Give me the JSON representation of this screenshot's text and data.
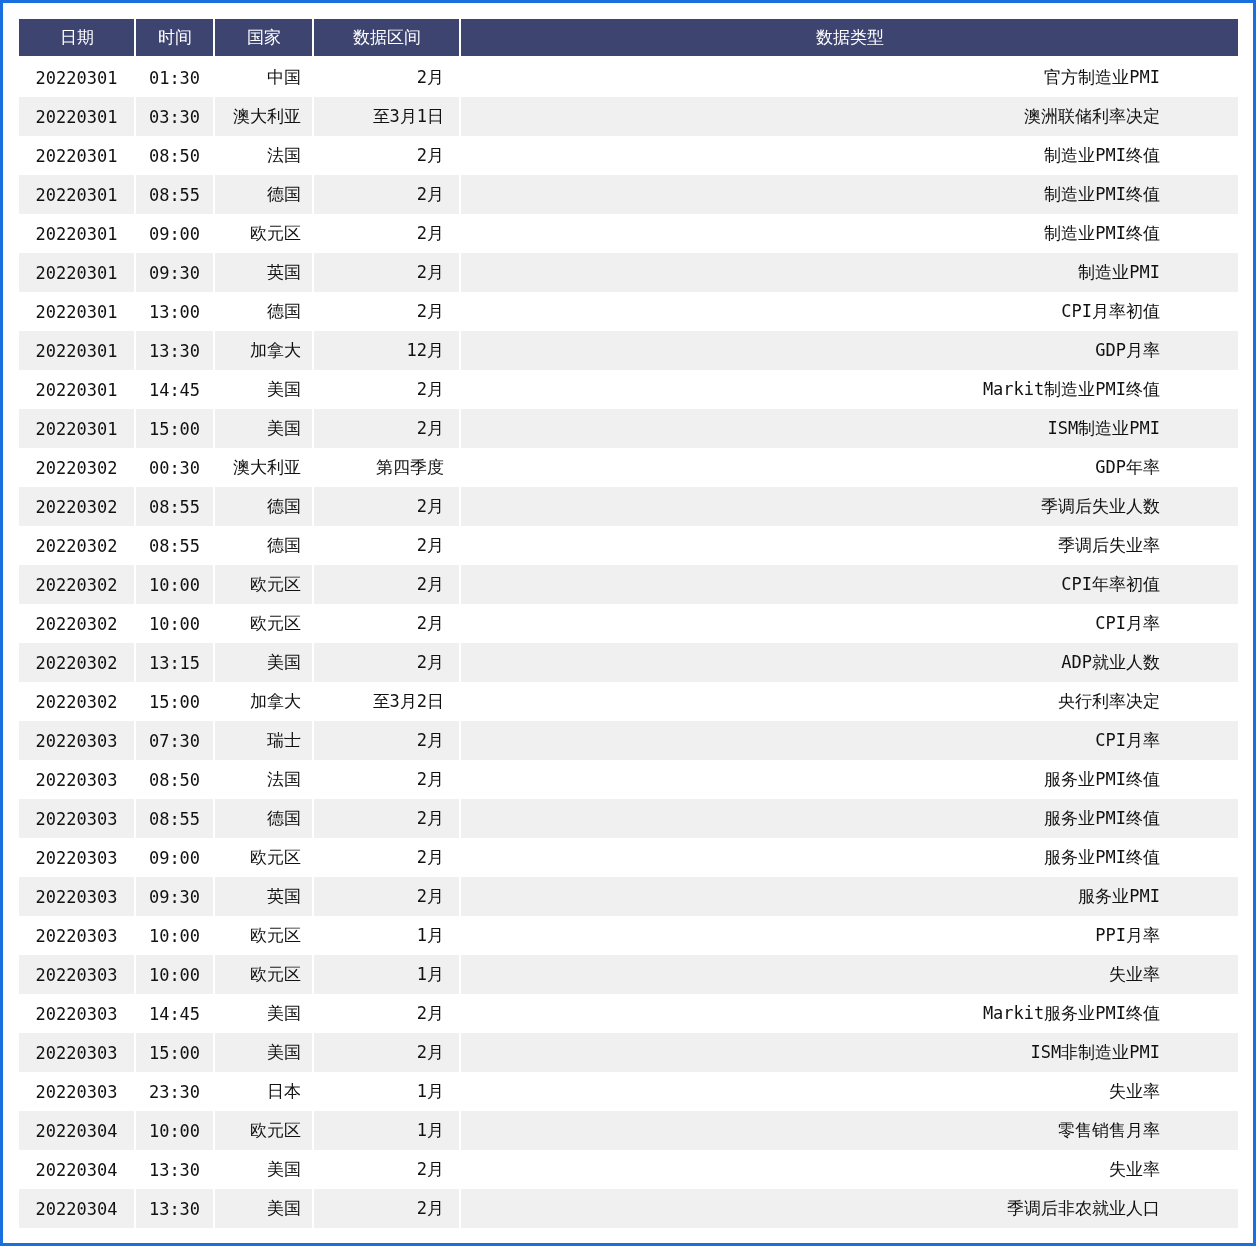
{
  "table": {
    "columns": [
      "日期",
      "时间",
      "国家",
      "数据区间",
      "数据类型"
    ],
    "rows": [
      [
        "20220301",
        "01:30",
        "中国",
        "2月",
        "官方制造业PMI"
      ],
      [
        "20220301",
        "03:30",
        "澳大利亚",
        "至3月1日",
        "澳洲联储利率决定"
      ],
      [
        "20220301",
        "08:50",
        "法国",
        "2月",
        "制造业PMI终值"
      ],
      [
        "20220301",
        "08:55",
        "德国",
        "2月",
        "制造业PMI终值"
      ],
      [
        "20220301",
        "09:00",
        "欧元区",
        "2月",
        "制造业PMI终值"
      ],
      [
        "20220301",
        "09:30",
        "英国",
        "2月",
        "制造业PMI"
      ],
      [
        "20220301",
        "13:00",
        "德国",
        "2月",
        "CPI月率初值"
      ],
      [
        "20220301",
        "13:30",
        "加拿大",
        "12月",
        "GDP月率"
      ],
      [
        "20220301",
        "14:45",
        "美国",
        "2月",
        "Markit制造业PMI终值"
      ],
      [
        "20220301",
        "15:00",
        "美国",
        "2月",
        "ISM制造业PMI"
      ],
      [
        "20220302",
        "00:30",
        "澳大利亚",
        "第四季度",
        "GDP年率"
      ],
      [
        "20220302",
        "08:55",
        "德国",
        "2月",
        "季调后失业人数"
      ],
      [
        "20220302",
        "08:55",
        "德国",
        "2月",
        "季调后失业率"
      ],
      [
        "20220302",
        "10:00",
        "欧元区",
        "2月",
        "CPI年率初值"
      ],
      [
        "20220302",
        "10:00",
        "欧元区",
        "2月",
        "CPI月率"
      ],
      [
        "20220302",
        "13:15",
        "美国",
        "2月",
        "ADP就业人数"
      ],
      [
        "20220302",
        "15:00",
        "加拿大",
        "至3月2日",
        "央行利率决定"
      ],
      [
        "20220303",
        "07:30",
        "瑞士",
        "2月",
        "CPI月率"
      ],
      [
        "20220303",
        "08:50",
        "法国",
        "2月",
        "服务业PMI终值"
      ],
      [
        "20220303",
        "08:55",
        "德国",
        "2月",
        "服务业PMI终值"
      ],
      [
        "20220303",
        "09:00",
        "欧元区",
        "2月",
        "服务业PMI终值"
      ],
      [
        "20220303",
        "09:30",
        "英国",
        "2月",
        "服务业PMI"
      ],
      [
        "20220303",
        "10:00",
        "欧元区",
        "1月",
        "PPI月率"
      ],
      [
        "20220303",
        "10:00",
        "欧元区",
        "1月",
        "失业率"
      ],
      [
        "20220303",
        "14:45",
        "美国",
        "2月",
        "Markit服务业PMI终值"
      ],
      [
        "20220303",
        "15:00",
        "美国",
        "2月",
        "ISM非制造业PMI"
      ],
      [
        "20220303",
        "23:30",
        "日本",
        "1月",
        "失业率"
      ],
      [
        "20220304",
        "10:00",
        "欧元区",
        "1月",
        "零售销售月率"
      ],
      [
        "20220304",
        "13:30",
        "美国",
        "2月",
        "失业率"
      ],
      [
        "20220304",
        "13:30",
        "美国",
        "2月",
        "季调后非农就业人口"
      ]
    ]
  }
}
